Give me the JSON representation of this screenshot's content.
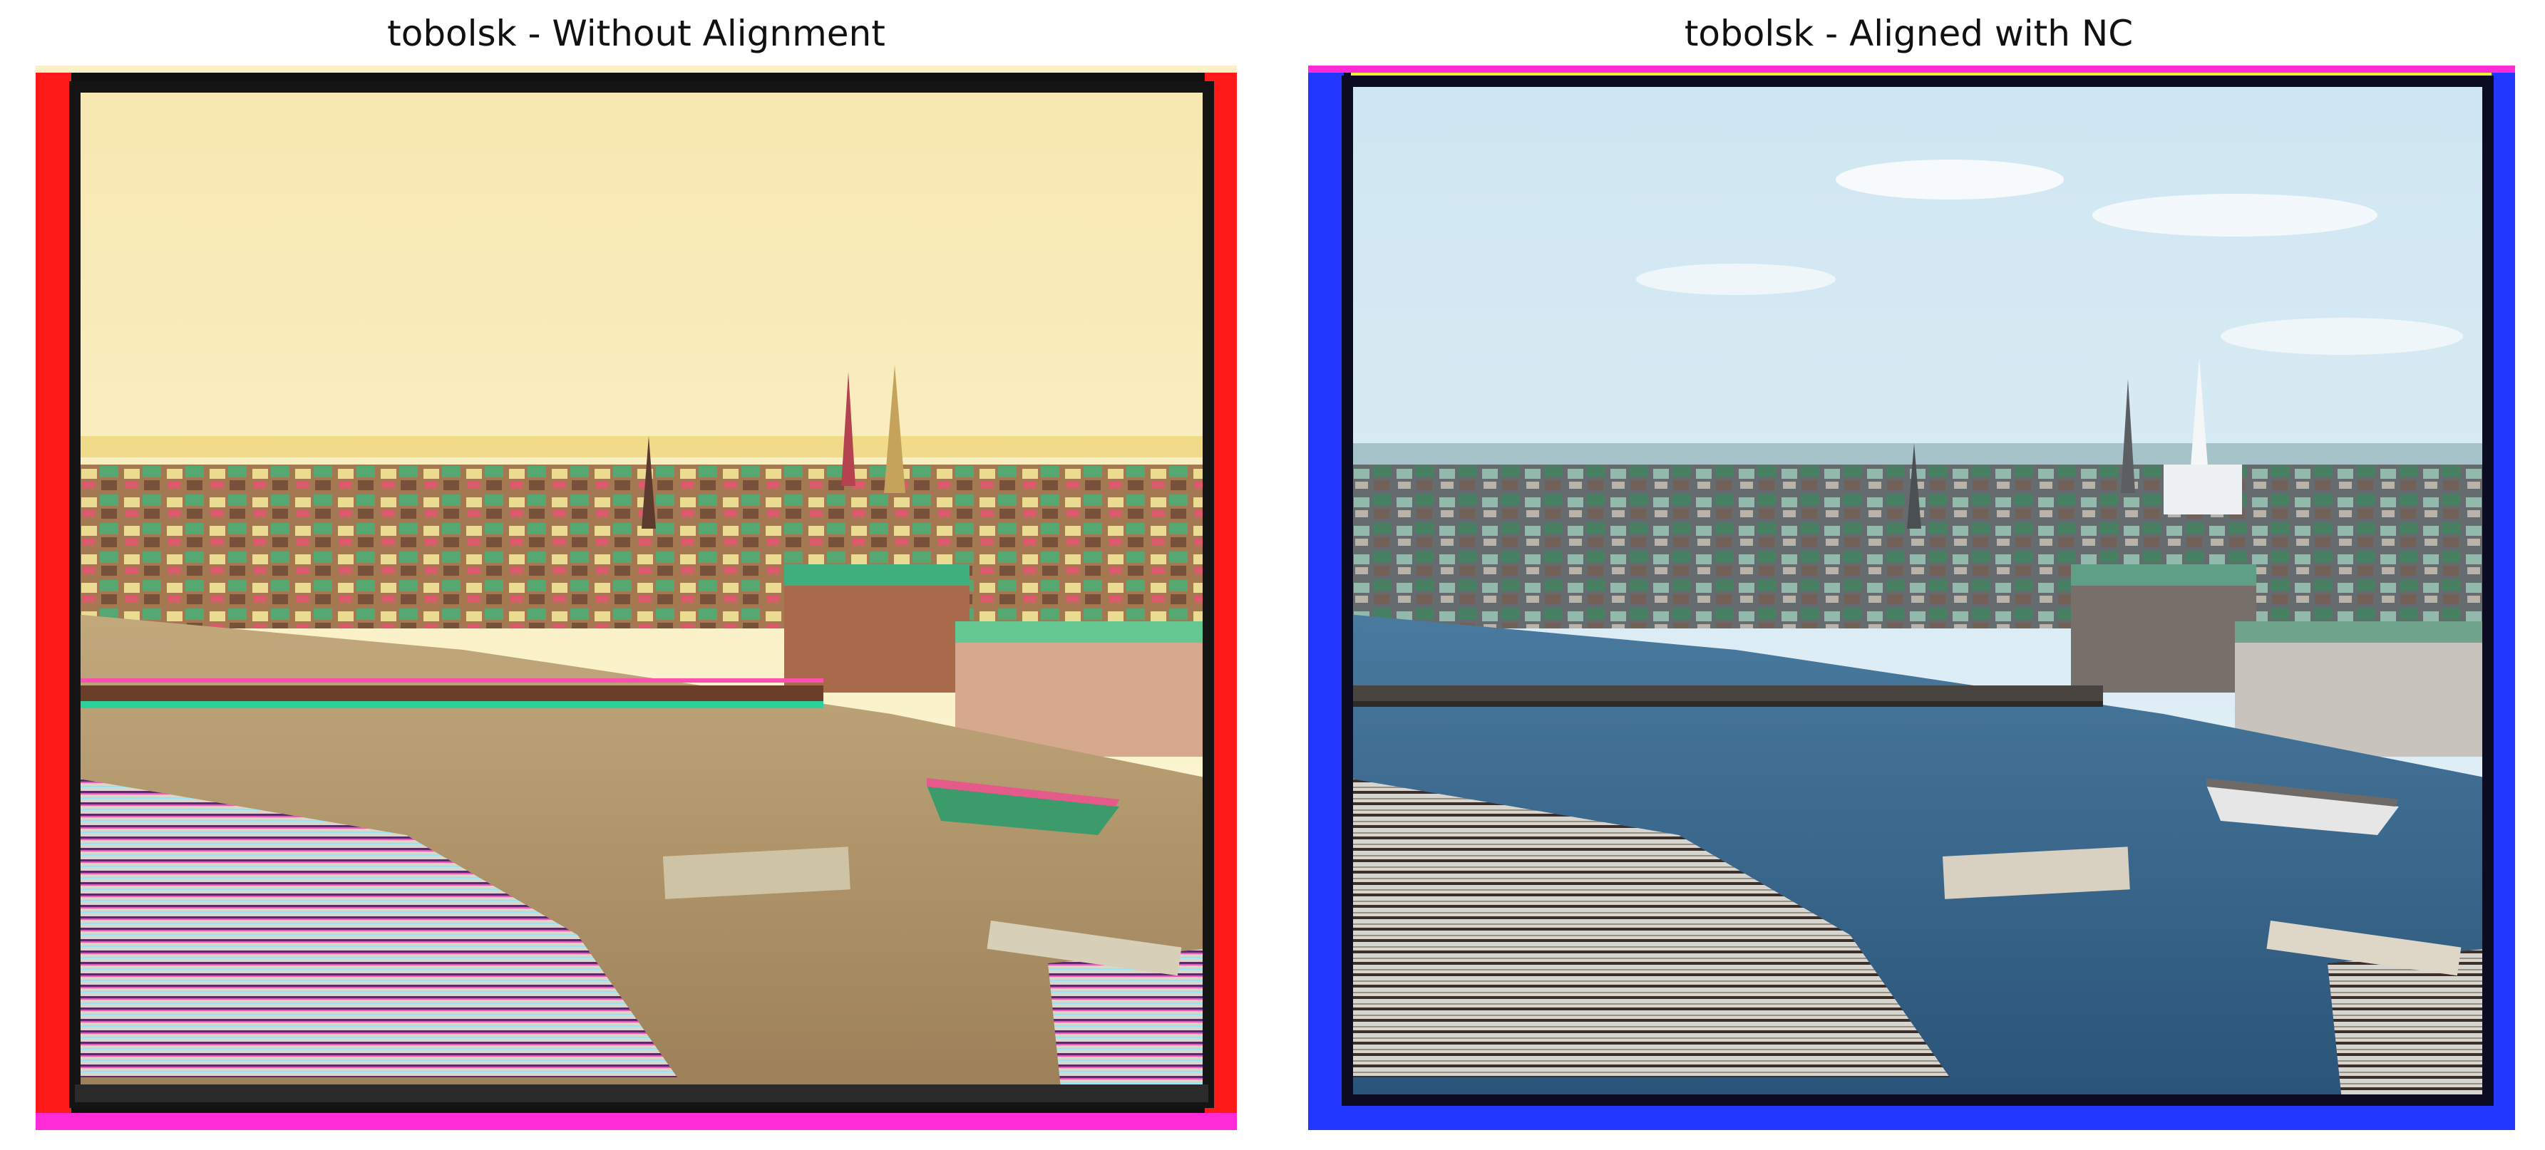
{
  "figure": {
    "panels": [
      {
        "title": "tobolsk - Without Alignment",
        "image": {
          "subject": "composite-photo",
          "variant": "unaligned",
          "palette": {
            "sky": "#fbf4cf",
            "sky_top": "#f7e7b0",
            "water": "#b79a6e",
            "border_dark": "#141414",
            "fringe_red": "#ff1a1a",
            "fringe_magenta": "#ff2bd6",
            "fringe_cyan": "#28f0e6",
            "fringe_yellow": "#f2f033"
          }
        }
      },
      {
        "title": "tobolsk - Aligned with NC",
        "image": {
          "subject": "composite-photo",
          "variant": "aligned",
          "palette": {
            "sky": "#dcebf3",
            "sky_top": "#cfe6f2",
            "water": "#2f5f86",
            "border_dark": "#0b0b22",
            "fringe_blue": "#2237ff",
            "fringe_magenta": "#ff2bd6",
            "fringe_yellow": "#f2f033"
          }
        }
      }
    ]
  }
}
